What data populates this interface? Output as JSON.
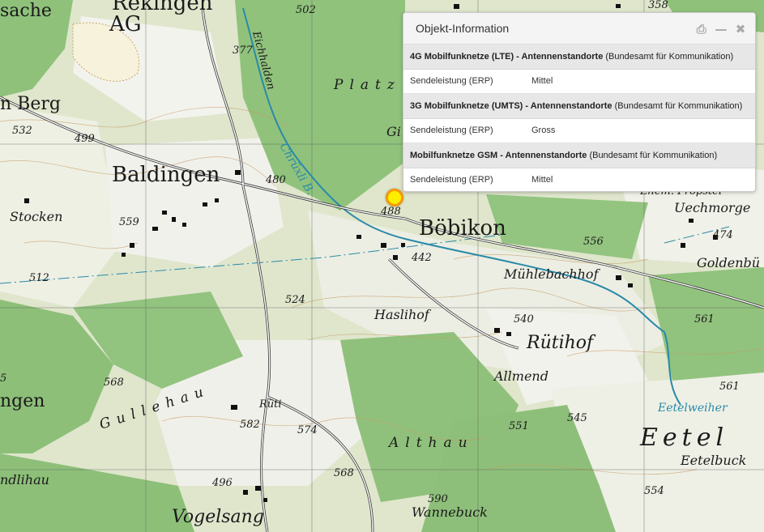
{
  "map": {
    "labels": {
      "rekingen": "Rekingen",
      "ag": "AG",
      "sache": "sache",
      "n_berg": "n Berg",
      "baldingen": "Baldingen",
      "stocken": "Stocken",
      "bobikon": "Böbikon",
      "platz": "Platz",
      "gi": "Gi",
      "eichhalden": "Eichhalden",
      "chrixli": "Chrüxli B.",
      "muhlebachhof": "Mühlebachhof",
      "haslihof": "Haslihof",
      "rutihof": "Rütihof",
      "allmend": "Allmend",
      "gullehau": "Gullehau",
      "ruti": "Rüti",
      "althau": "Althau",
      "vogelsang": "Vogelsang",
      "wannebuck": "Wannebuck",
      "eetel": "Eetel",
      "eetelbuck": "Eetelbuck",
      "eetelweiher": "Eetelweiher",
      "uechmorge": "Uechmorge",
      "goldenbu": "Goldenbü",
      "propstei": "Ehem. Propstei",
      "ngen": "ngen",
      "ndlihau": "ndlihau"
    },
    "heights": [
      "502",
      "358",
      "377",
      "532",
      "499",
      "480",
      "488",
      "559",
      "512",
      "442",
      "556",
      "474",
      "524",
      "540",
      "561",
      "568",
      "545",
      "551",
      "574",
      "582",
      "496",
      "568",
      "590",
      "554",
      "561",
      "5"
    ]
  },
  "marker": {
    "color": "#ffee00",
    "border": "#f59a00"
  },
  "panel": {
    "title": "Objekt-Information",
    "tools": {
      "print": "⎙",
      "minimize": "—",
      "close": "✖"
    },
    "layers": [
      {
        "name": "4G Mobilfunknetze (LTE) - Antennenstandorte",
        "source": "(Bundesamt für Kommunikation)",
        "attr_key": "Sendeleistung (ERP)",
        "attr_value": "Mittel"
      },
      {
        "name": "3G Mobilfunknetze (UMTS) - Antennenstandorte",
        "source": "(Bundesamt für Kommunikation)",
        "attr_key": "Sendeleistung (ERP)",
        "attr_value": "Gross"
      },
      {
        "name": "Mobilfunknetze GSM - Antennenstandorte",
        "source": "(Bundesamt für Kommunikation)",
        "attr_key": "Sendeleistung (ERP)",
        "attr_value": "Mittel"
      }
    ]
  }
}
